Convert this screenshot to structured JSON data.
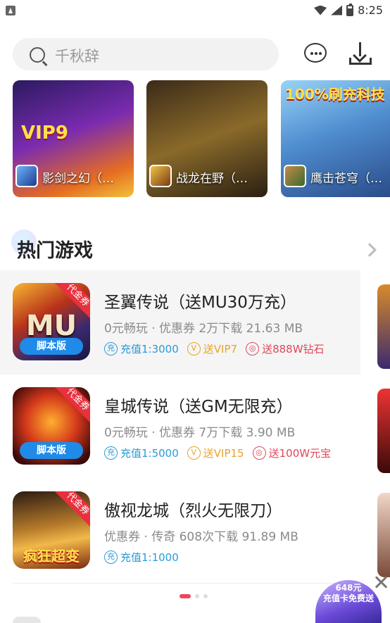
{
  "status": {
    "time": "8:25"
  },
  "search": {
    "placeholder": "千秋辞"
  },
  "banners": [
    {
      "name": "影剑之幻（…",
      "deco": "VIP9"
    },
    {
      "name": "战龙在野（…",
      "deco": ""
    },
    {
      "name": "鹰击苍穹（…",
      "deco": "100%刷充科技"
    }
  ],
  "section": {
    "title": "热门游戏"
  },
  "games": [
    {
      "title": "圣翼传说（送MU30万充）",
      "meta": "0元畅玩 · 优惠券  2万下载  21.63 MB",
      "corner": "代金券",
      "ribbon": "脚本版",
      "art": "MU",
      "tags": [
        {
          "icon": "充",
          "text": "充值1:3000",
          "color": "blue"
        },
        {
          "icon": "V",
          "text": "送VIP7",
          "color": "orange"
        },
        {
          "icon": "◎",
          "text": "送888W钻石",
          "color": "red"
        }
      ]
    },
    {
      "title": "皇城传说（送GM无限充）",
      "meta": "0元畅玩 · 优惠券  7万下载  3.90 MB",
      "corner": "代金券",
      "ribbon": "脚本版",
      "art": "",
      "tags": [
        {
          "icon": "充",
          "text": "充值1:5000",
          "color": "blue"
        },
        {
          "icon": "V",
          "text": "送VIP15",
          "color": "orange"
        },
        {
          "icon": "◎",
          "text": "送100W元宝",
          "color": "red"
        }
      ]
    },
    {
      "title": "傲视龙城（烈火无限刀）",
      "meta": "优惠券 · 传奇  608次下载  91.89 MB",
      "corner": "代金券",
      "ribbon": "",
      "art": "疯狂超变",
      "tags": [
        {
          "icon": "充",
          "text": "充值1:1000",
          "color": "blue"
        }
      ]
    }
  ],
  "float_ad": {
    "text": "648元\n充值卡免费送"
  },
  "colors": {
    "accent": "#f0455a",
    "tag_blue": "#2a9bd8",
    "tag_orange": "#e8a32a",
    "tag_red": "#e2465a"
  }
}
